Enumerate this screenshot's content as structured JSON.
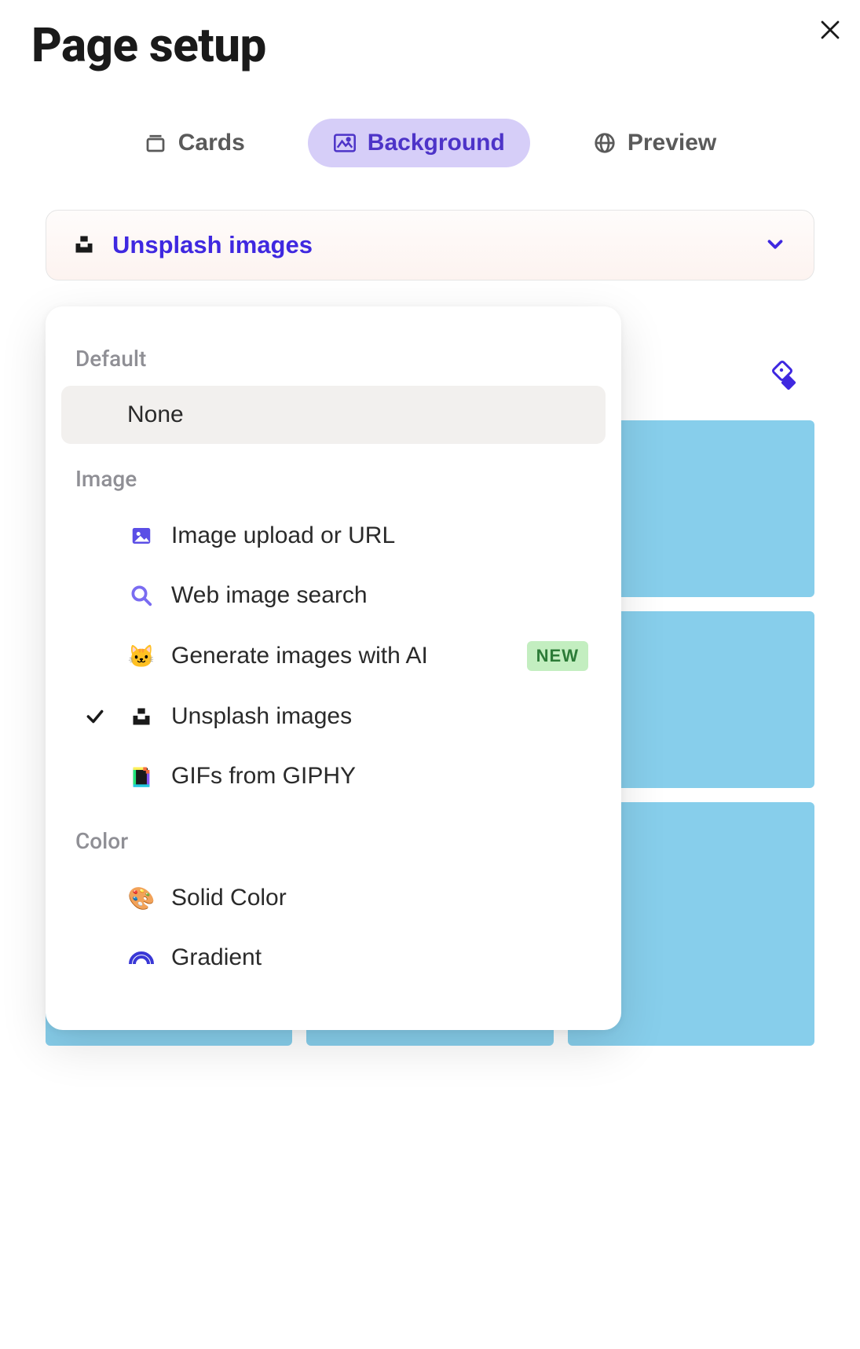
{
  "title": "Page setup",
  "tabs": {
    "cards": "Cards",
    "background": "Background",
    "preview": "Preview"
  },
  "selector": {
    "current_label": "Unsplash images"
  },
  "dropdown": {
    "group_default": "Default",
    "group_image": "Image",
    "group_color": "Color",
    "none": "None",
    "image_upload": "Image upload or URL",
    "web_search": "Web image search",
    "generate_ai": "Generate images with AI",
    "unsplash": "Unsplash images",
    "gifs": "GIFs from GIPHY",
    "solid_color": "Solid Color",
    "gradient": "Gradient",
    "badge_new": "NEW"
  }
}
